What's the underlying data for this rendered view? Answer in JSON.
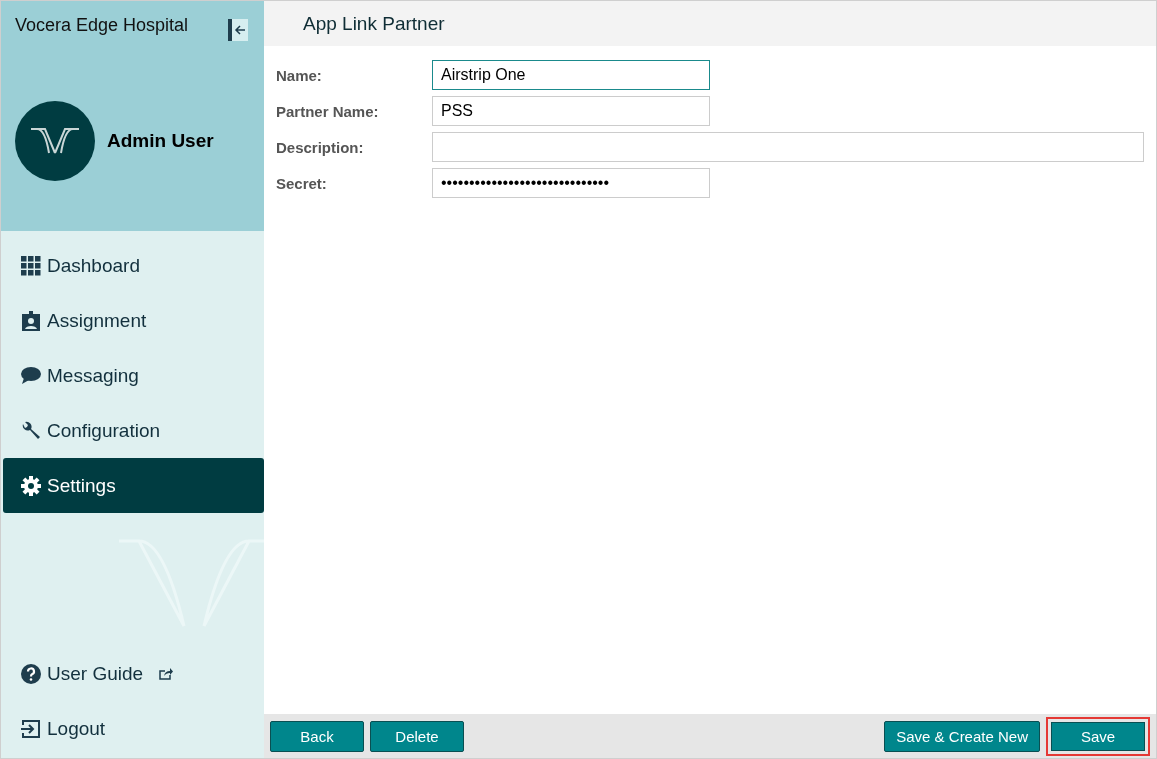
{
  "sidebar": {
    "hospital": "Vocera Edge Hospital",
    "user": "Admin User",
    "items": [
      {
        "label": "Dashboard",
        "selected": false
      },
      {
        "label": "Assignment",
        "selected": false
      },
      {
        "label": "Messaging",
        "selected": false
      },
      {
        "label": "Configuration",
        "selected": false
      },
      {
        "label": "Settings",
        "selected": true
      }
    ],
    "bottom_items": [
      {
        "label": "User Guide",
        "kind": "external"
      },
      {
        "label": "Logout",
        "kind": "plain"
      }
    ]
  },
  "page": {
    "title": "App Link Partner",
    "fields": [
      {
        "label": "Name:",
        "value": "Airstrip One",
        "kind": "short",
        "focused": true
      },
      {
        "label": "Partner Name:",
        "value": "PSS",
        "kind": "short",
        "focused": false
      },
      {
        "label": "Description:",
        "kind": "long",
        "focused": false
      },
      {
        "label": "Secret:",
        "value": "••••••••••••••••••••••••••••••",
        "kind": "short",
        "focused": false
      }
    ]
  },
  "footer": {
    "left_buttons": [
      {
        "label": "Back"
      },
      {
        "label": "Delete"
      }
    ],
    "right_buttons": [
      {
        "label": "Save & Create New",
        "highlighted": false
      },
      {
        "label": "Save",
        "highlighted": true
      }
    ]
  }
}
